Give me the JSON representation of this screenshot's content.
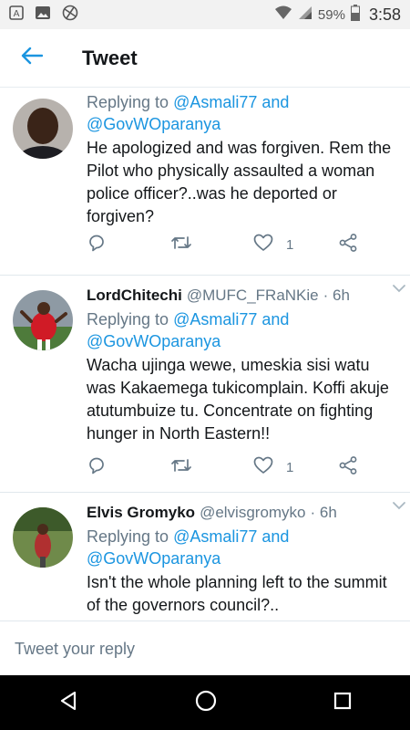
{
  "status_bar": {
    "battery": "59%",
    "time": "3:58",
    "icons": [
      "notification-a-icon",
      "image-icon",
      "vpn-icon",
      "wifi-icon",
      "signal-icon",
      "battery-icon"
    ]
  },
  "app_bar": {
    "title": "Tweet",
    "back_icon": "arrow-left-icon"
  },
  "tweets": [
    {
      "name": "",
      "handle": "",
      "time": "",
      "replying_prefix": "Replying to",
      "replying_user1": "@Asmali77",
      "replying_and": "and",
      "replying_user2": "@GovWOparanya",
      "text": "He apologized and was forgiven. Rem the Pilot who physically assaulted a woman police officer?..was he deported or forgiven?",
      "like_count": "1"
    },
    {
      "name": "LordChitechi",
      "handle": "@MUFC_FRaNKie",
      "time": "· 6h",
      "replying_prefix": "Replying to",
      "replying_user1": "@Asmali77",
      "replying_and": "and",
      "replying_user2": "@GovWOparanya",
      "text": "Wacha ujinga wewe, umeskia sisi watu was Kakaemega tukicomplain. Koffi akuje atutumbuize tu. Concentrate on fighting hunger in North Eastern!!",
      "like_count": "1"
    },
    {
      "name": "Elvis Gromyko",
      "handle": "@elvisgromyko",
      "time": "· 6h",
      "replying_prefix": "Replying to",
      "replying_user1": "@Asmali77",
      "replying_and": "and",
      "replying_user2": "@GovWOparanya",
      "text": "Isn't the whole planning left to the summit of the governors council?..",
      "like_count": ""
    }
  ],
  "composer": {
    "placeholder": "Tweet your reply"
  },
  "colors": {
    "accent": "#1b95e0",
    "secondary_text": "#657786",
    "primary_text": "#14171a",
    "divider": "#e1e8ed"
  }
}
